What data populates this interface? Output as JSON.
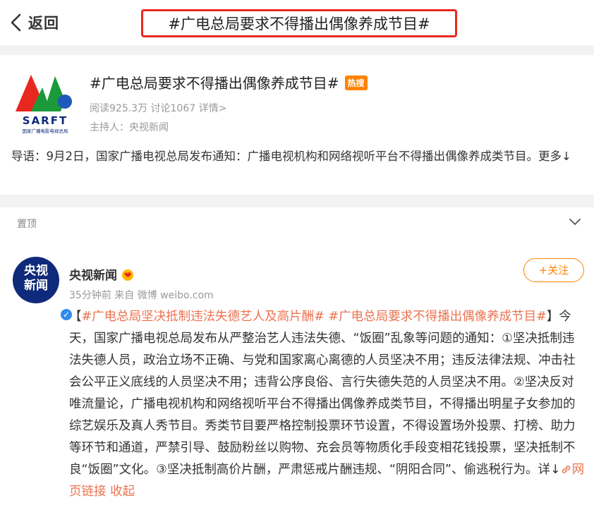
{
  "nav": {
    "back_label": "返回",
    "page_title": "#广电总局要求不得播出偶像养成节目#"
  },
  "topic": {
    "title": "#广电总局要求不得播出偶像养成节目#",
    "hot_badge": "热搜",
    "stats_prefix": "阅读925.3万 讨论1067 ",
    "detail_link": "详情>",
    "host": "主持人：央视新闻",
    "intro_text": "导语：9月2日，国家广播电视总局发布通知：广播电视机构和网络视听平台不得播出偶像养成类节目。",
    "intro_more": "更多↓",
    "logo_text": "SARFT",
    "logo_subtext": "国家广播电影电视总局"
  },
  "pinned": {
    "label": "置顶"
  },
  "post": {
    "author": "央视新闻",
    "avatar_line1": "央视",
    "avatar_line2": "新闻",
    "verified_mark": "✓",
    "meta": "35分钟前 来自 微博 weibo.com",
    "follow_label": "+关注",
    "bracket_open": "【",
    "tag1": "#广电总局坚决抵制违法失德艺人及高片酬#",
    "space": " ",
    "tag2": "#广电总局要求不得播出偶像养成节目#",
    "bracket_close": "】",
    "content": "今天，国家广播电视总局发布从严整治艺人违法失德、“饭圈”乱象等问题的通知：①坚决抵制违法失德人员，政治立场不正确、与党和国家离心离德的人员坚决不用；违反法律法规、冲击社会公平正义底线的人员坚决不用；违背公序良俗、言行失德失范的人员坚决不用。②坚决反对唯流量论，广播电视机构和网络视听平台不得播出偶像养成类节目，不得播出明星子女参加的综艺娱乐及真人秀节目。秀类节目要严格控制投票环节设置，不得设置场外投票、打榜、助力等环节和通道，严禁引导、鼓励粉丝以购物、充会员等物质化手段变相花钱投票，坚决抵制不良“饭圈”文化。③坚决抵制高价片酬，严肃惩戒片酬违规、“阴阳合同”、偷逃税行为。",
    "expand_label": "详↓",
    "web_link_label": "网页链接",
    "collapse_label": "收起"
  },
  "colors": {
    "accent_orange": "#ff8200",
    "topic_link": "#eb7350",
    "highlight_box": "#e8281e",
    "separator": "#f2f2f2"
  },
  "icons": [
    "back-chevron-icon",
    "chevron-down-icon",
    "vip-heart-icon",
    "verified-icon",
    "link-icon"
  ]
}
